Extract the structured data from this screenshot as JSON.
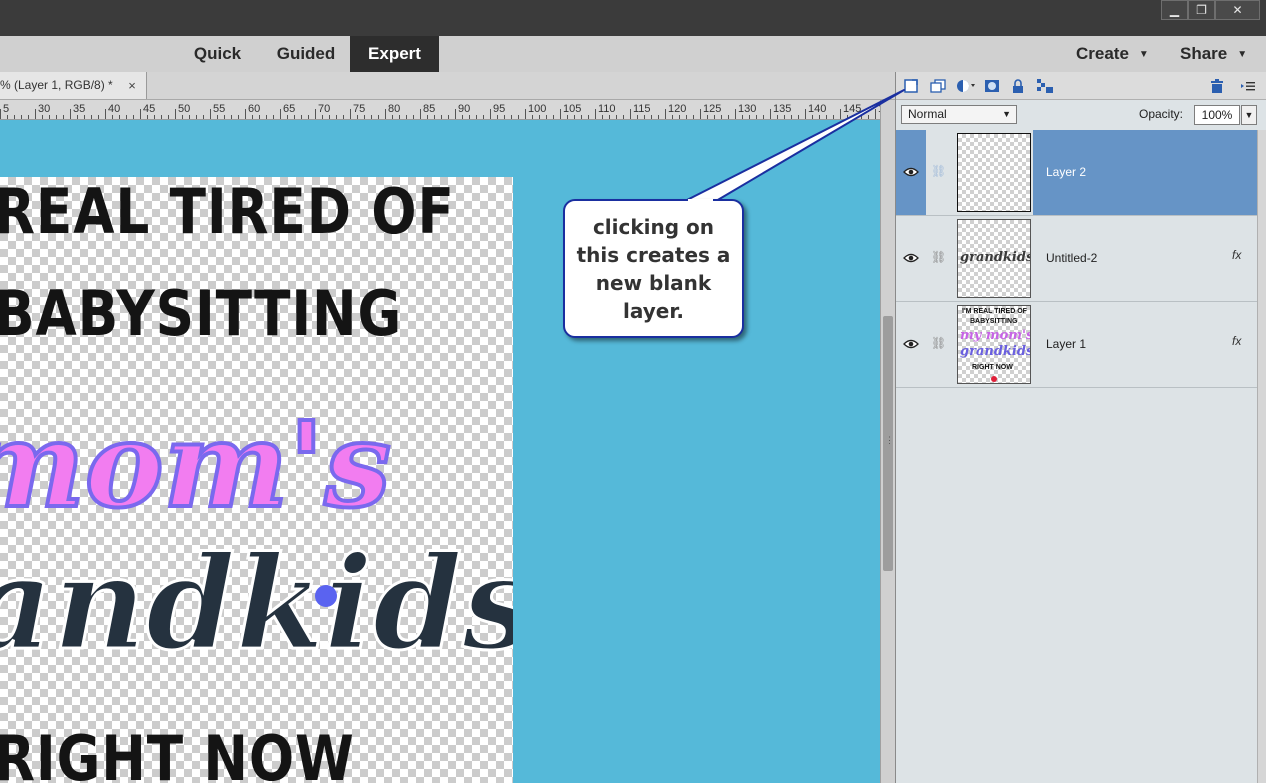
{
  "window": {
    "controls": {
      "minimize": "▁",
      "restore": "❐",
      "close": "✕"
    }
  },
  "modes": {
    "quick": "Quick",
    "guided": "Guided",
    "expert": "Expert",
    "active": "expert"
  },
  "topbar": {
    "create": "Create",
    "share": "Share"
  },
  "document": {
    "tab_title": "% (Layer 1, RGB/8) *",
    "tab_close": "×",
    "ruler_labels": [
      "5",
      "30",
      "35",
      "40",
      "45",
      "50",
      "55",
      "60",
      "65",
      "70",
      "75",
      "80",
      "85",
      "90",
      "95",
      "100",
      "105",
      "110",
      "115",
      "120",
      "125",
      "130",
      "135",
      "140",
      "145",
      "15"
    ],
    "artwork": {
      "line1": "REAL TIRED OF",
      "line2": "BABYSITTING",
      "line3": "mom's",
      "line4": "andkids",
      "line5": "RIGHT NOW"
    }
  },
  "annotation": {
    "text": "clicking on this creates a new blank layer."
  },
  "layers_panel": {
    "toolbar_icons": [
      "new-layer-icon",
      "new-group-icon",
      "adjustment-layer-icon",
      "layer-mask-icon",
      "lock-all-icon",
      "lock-transparency-icon",
      "trash-icon",
      "panel-menu-icon"
    ],
    "blend_mode": "Normal",
    "opacity_label": "Opacity:",
    "opacity_value": "100%",
    "layers": [
      {
        "name": "Layer 2",
        "selected": true,
        "fx": ""
      },
      {
        "name": "Untitled-2",
        "selected": false,
        "fx": "fx"
      },
      {
        "name": "Layer 1",
        "selected": false,
        "fx": "fx"
      }
    ],
    "thumb_texts": {
      "untitled2": "grandkids",
      "layer1_line1": "I'M REAL TIRED OF",
      "layer1_line2": "BABYSITTING",
      "layer1_line3": "my mom's",
      "layer1_line4": "grandkids",
      "layer1_line5": "RIGHT NOW"
    }
  },
  "colors": {
    "canvas_bg": "#55b9d9",
    "selected_layer": "#6694c6",
    "callout_border": "#1a2fa0",
    "active_mode": "#2d2d2d"
  }
}
